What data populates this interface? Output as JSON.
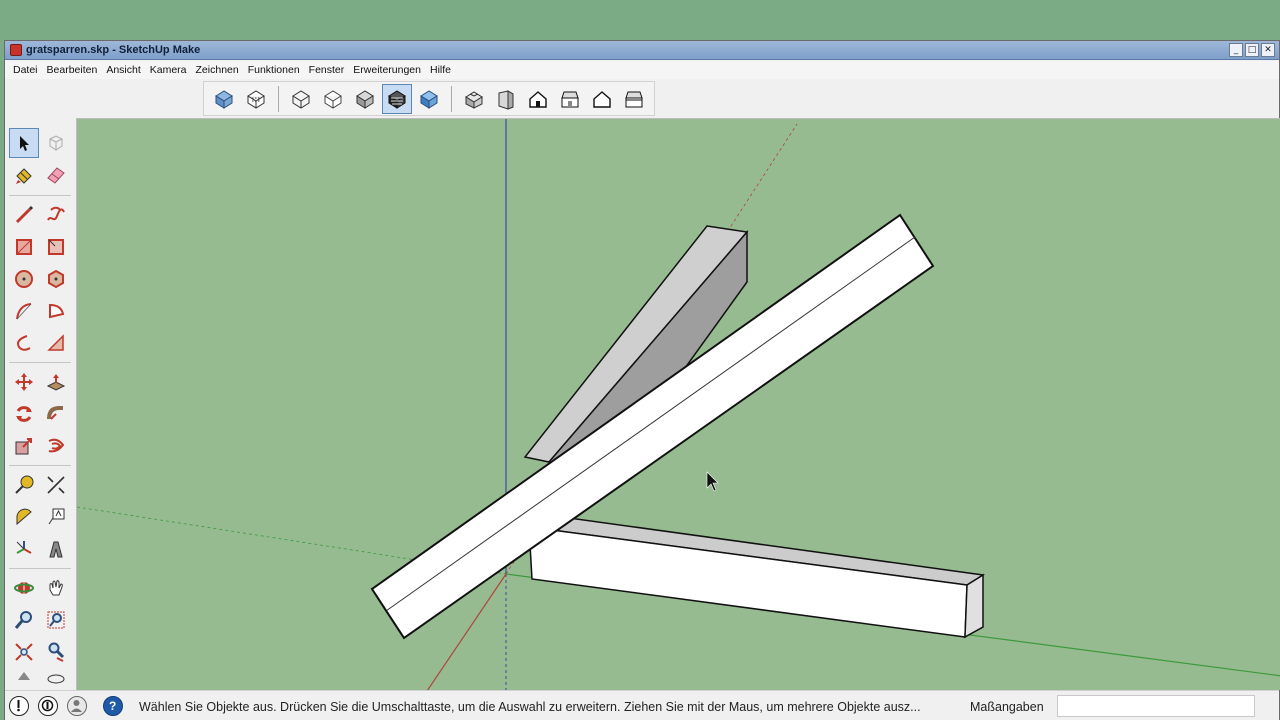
{
  "window": {
    "title": "gratsparren.skp - SketchUp Make"
  },
  "window_buttons": {
    "minimize": "_",
    "maximize": "□",
    "close": "✕"
  },
  "menu": [
    "Datei",
    "Bearbeiten",
    "Ansicht",
    "Kamera",
    "Zeichnen",
    "Funktionen",
    "Fenster",
    "Erweiterungen",
    "Hilfe"
  ],
  "toolbar_top": {
    "styles": [
      "x-ray-icon",
      "back-edges-icon",
      "wireframe-icon",
      "hidden-line-icon",
      "shaded-icon",
      "shaded-textures-icon",
      "monochrome-icon"
    ],
    "active_style": "shaded-textures-icon",
    "views": [
      "iso-view-icon",
      "top-view-icon",
      "front-view-icon",
      "right-view-icon",
      "back-view-icon",
      "left-view-icon"
    ]
  },
  "toolbar_left": {
    "tools": [
      "select-icon",
      "component-icon",
      "paint-bucket-icon",
      "eraser-icon",
      "line-icon",
      "freehand-icon",
      "rectangle-icon",
      "rotated-rectangle-icon",
      "circle-icon",
      "polygon-icon",
      "arc-icon",
      "pie-icon",
      "two-point-arc-icon",
      "three-point-arc-icon",
      "move-icon",
      "push-pull-icon",
      "rotate-icon",
      "follow-me-icon",
      "scale-icon",
      "offset-icon",
      "tape-measure-icon",
      "dimension-icon",
      "protractor-icon",
      "text-icon",
      "axes-icon",
      "3d-text-icon",
      "orbit-icon",
      "pan-icon",
      "zoom-icon",
      "zoom-window-icon",
      "zoom-extents-icon",
      "walk-icon"
    ],
    "active_tool": "select-icon"
  },
  "colors": {
    "viewport_bg": "#97bb91",
    "desktop_bg": "#7aab84",
    "axis_red": "#b0443a",
    "axis_green": "#3c9a3c",
    "axis_blue": "#3a4e9e"
  },
  "status": {
    "message": "Wählen Sie Objekte aus. Drücken Sie die Umschalttaste, um die Auswahl zu erweitern. Ziehen Sie mit der Maus, um mehrere Objekte ausz...",
    "measurements_label": "Maßangaben",
    "measurements_value": "",
    "icons": [
      "geo-location-icon",
      "credits-icon",
      "user-icon",
      "help-icon"
    ]
  }
}
